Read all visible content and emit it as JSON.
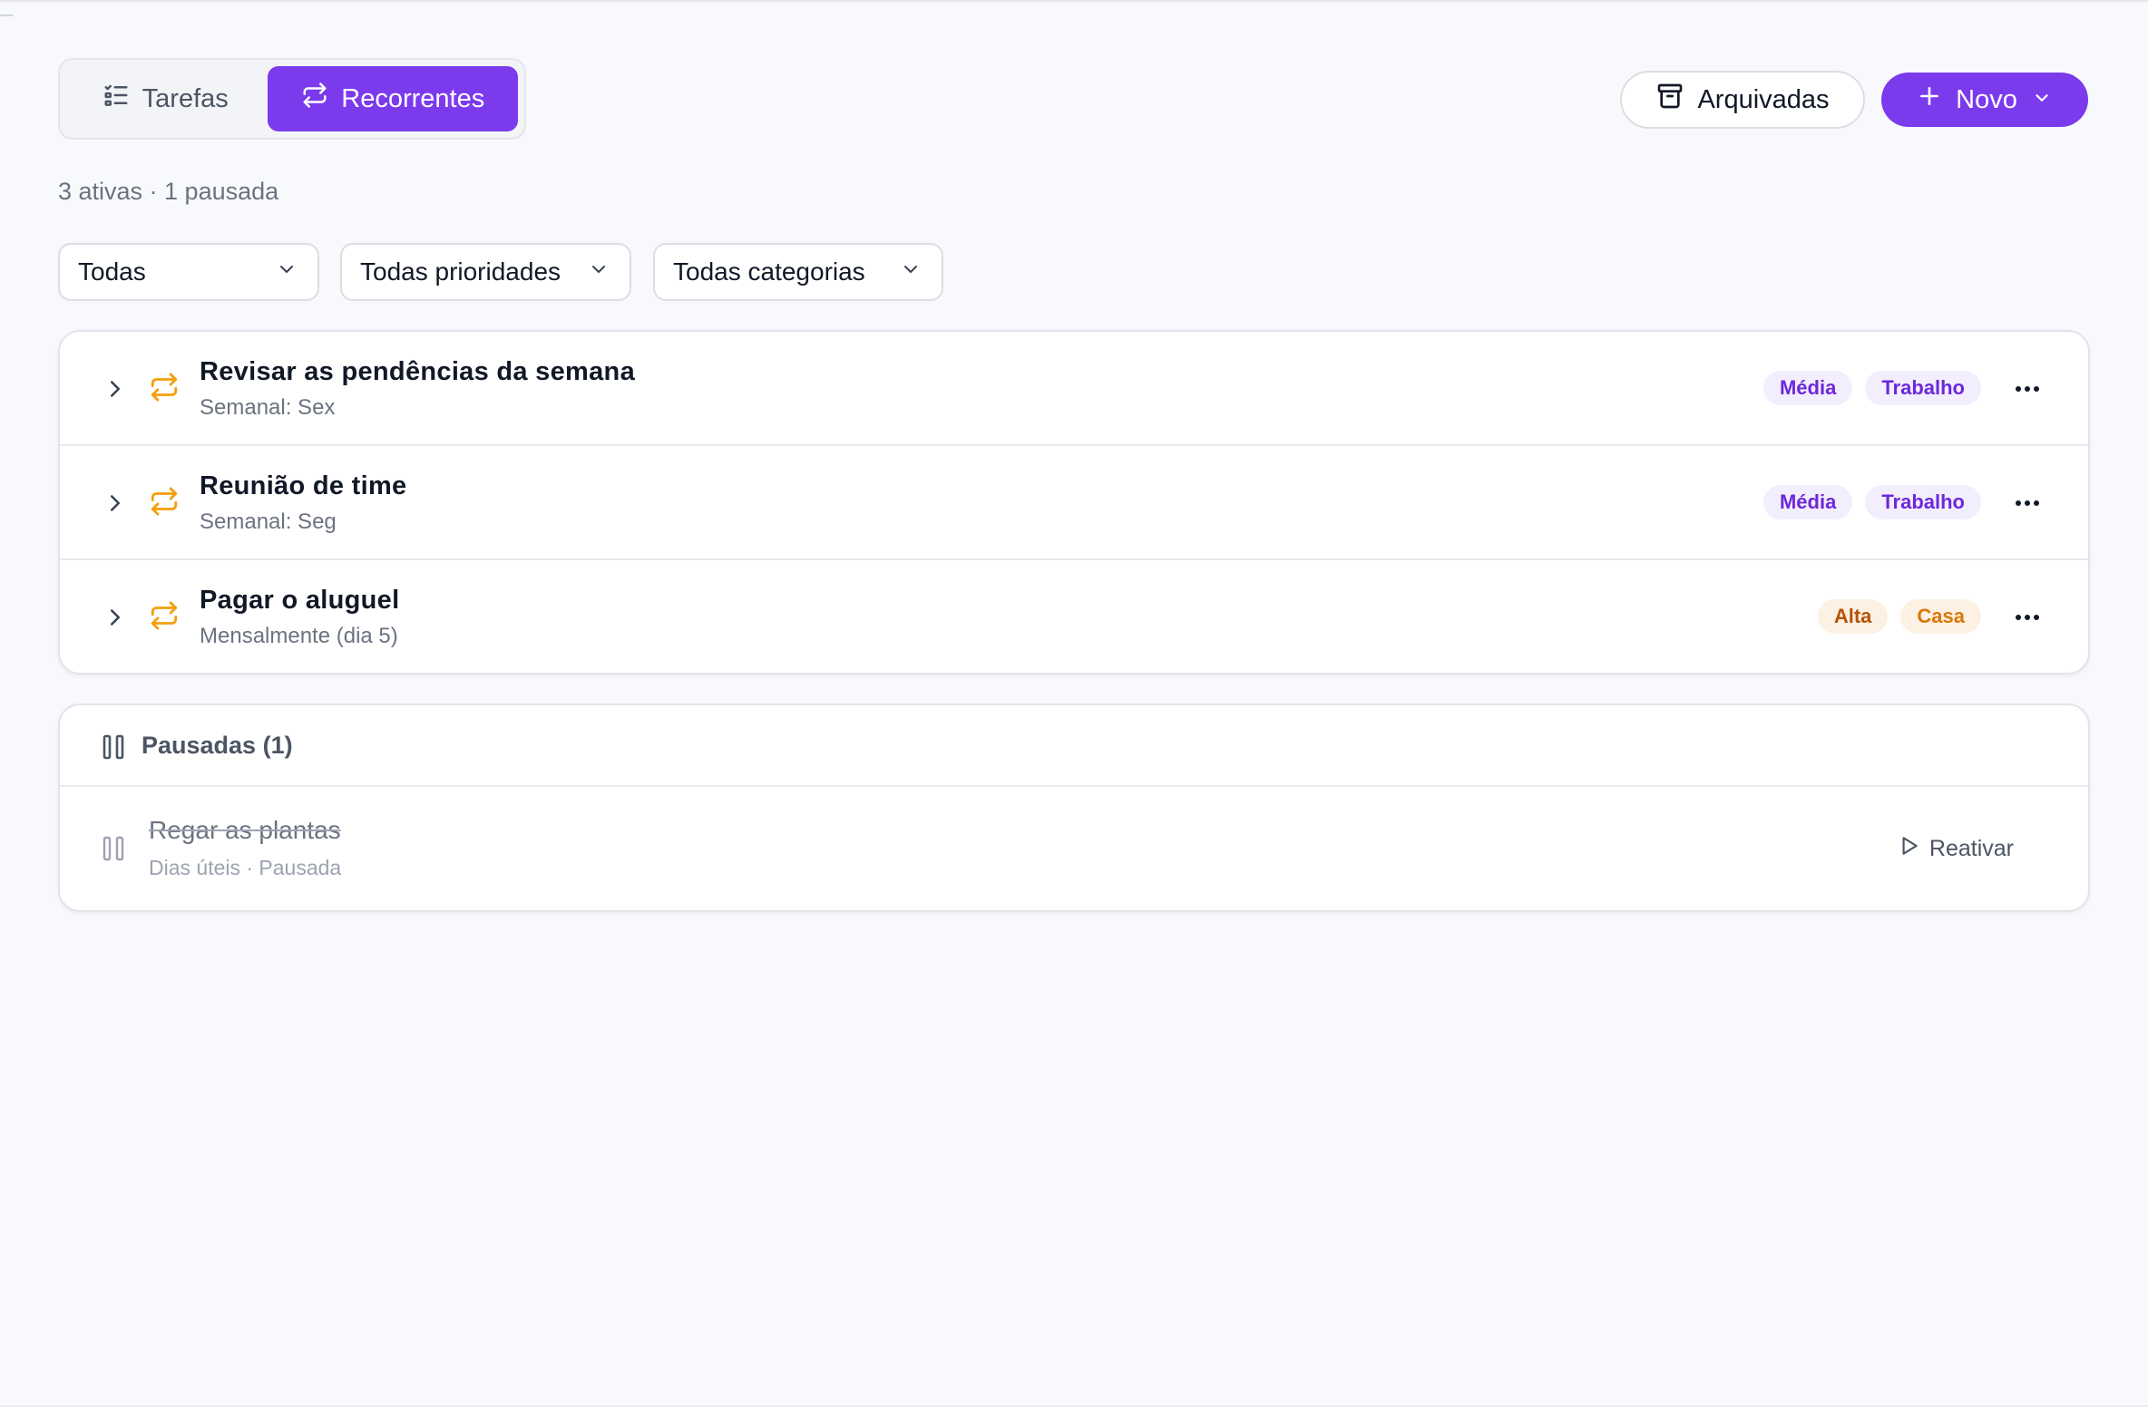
{
  "tabs": {
    "tarefas": {
      "label": "Tarefas",
      "icon": "list-check-icon"
    },
    "recorrentes": {
      "label": "Recorrentes",
      "icon": "repeat-icon",
      "active": true
    }
  },
  "actions": {
    "archived_label": "Arquivadas",
    "archived_icon": "archive-icon",
    "new_label": "Novo",
    "new_icon": "plus-icon"
  },
  "summary": "3 ativas · 1 pausada",
  "filters": [
    {
      "selected": "Todas"
    },
    {
      "selected": "Todas prioridades"
    },
    {
      "selected": "Todas categorias"
    }
  ],
  "recurring": [
    {
      "title": "Revisar as pendências da semana",
      "schedule": "Semanal: Sex",
      "priority": "Média",
      "category": "Trabalho"
    },
    {
      "title": "Reunião de time",
      "schedule": "Semanal: Seg",
      "priority": "Média",
      "category": "Trabalho"
    },
    {
      "title": "Pagar o aluguel",
      "schedule": "Mensalmente (dia 5)",
      "priority": "Alta",
      "category": "Casa"
    }
  ],
  "paused": {
    "header": "Pausadas (1)",
    "items": [
      {
        "title": "Regar as plantas",
        "subtitle": "Dias úteis · Pausada",
        "action": "Reativar"
      }
    ]
  },
  "colors": {
    "accent": "#7c3aed",
    "repeat_icon": "#f59e0b",
    "tag_media_bg": "#f3eefe",
    "tag_media_fg": "#6d28d9",
    "tag_alta_bg": "#fdf1e3",
    "tag_alta_fg": "#b45309",
    "tag_casa_bg": "#fdf1e3",
    "tag_casa_fg": "#d97706"
  }
}
